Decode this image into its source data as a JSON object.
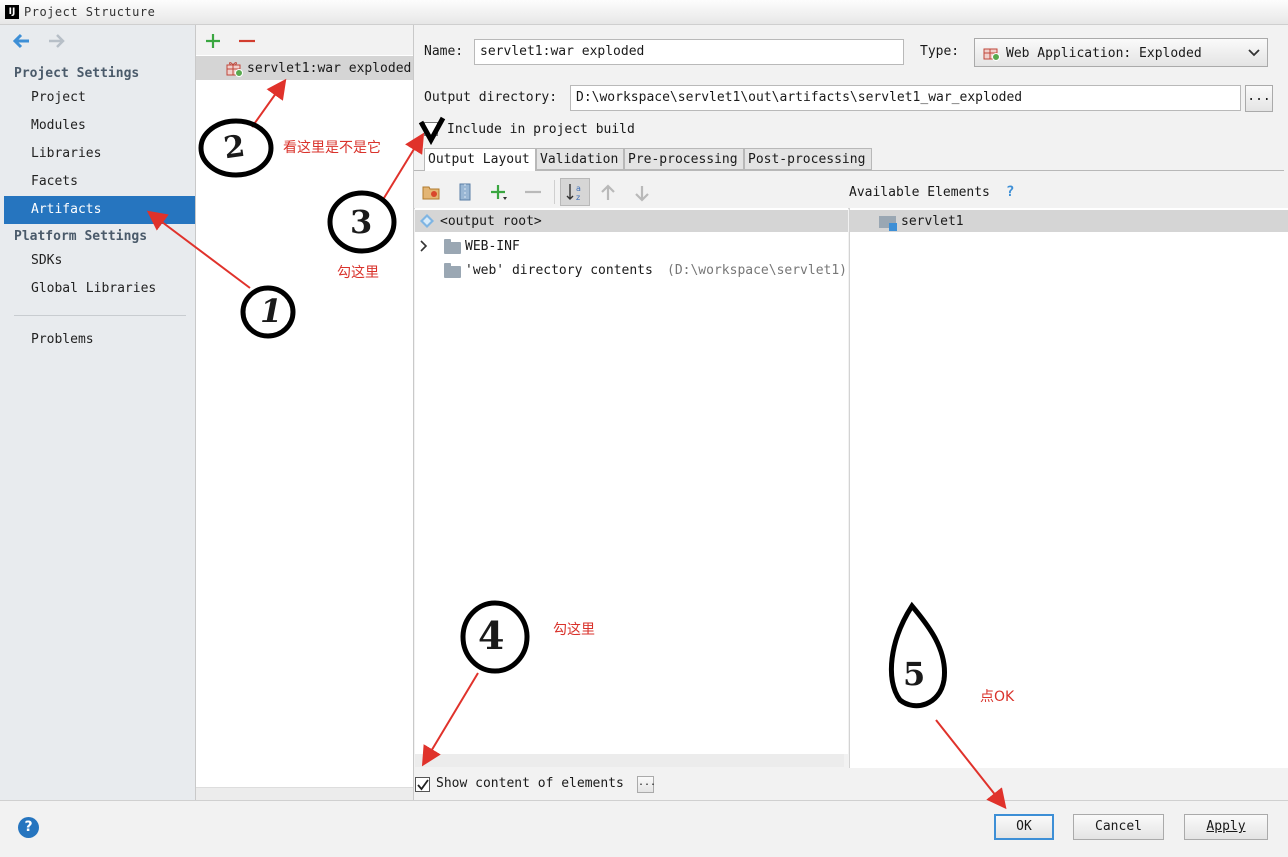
{
  "window": {
    "title": "Project Structure",
    "logo": "IJ"
  },
  "nav": {
    "section_project": "Project Settings",
    "items_project": [
      "Project",
      "Modules",
      "Libraries",
      "Facets",
      "Artifacts"
    ],
    "selected": "Artifacts",
    "section_platform": "Platform Settings",
    "items_platform": [
      "SDKs",
      "Global Libraries"
    ],
    "problems": "Problems"
  },
  "artifacts": {
    "list": [
      "servlet1:war exploded"
    ]
  },
  "form": {
    "name_label": "Name:",
    "name_value": "servlet1:war exploded",
    "type_label": "Type:",
    "type_value": "Web Application: Exploded",
    "output_label": "Output directory:",
    "output_value": "D:\\workspace\\servlet1\\out\\artifacts\\servlet1_war_exploded",
    "browse_label": "...",
    "include_label": "Include in project build",
    "include_checked": true
  },
  "tabs": [
    "Output Layout",
    "Validation",
    "Pre-processing",
    "Post-processing"
  ],
  "active_tab": "Output Layout",
  "layout": {
    "available_label": "Available Elements",
    "help": "?",
    "tree": [
      {
        "label": "<output root>",
        "selected": true
      },
      {
        "label": "WEB-INF",
        "expandable": true
      },
      {
        "label": "'web' directory contents",
        "hint": "(D:\\workspace\\servlet1)"
      }
    ],
    "available": [
      "servlet1"
    ],
    "show_content_label": "Show content of elements",
    "show_content_checked": true,
    "ellipsis": "..."
  },
  "buttons": {
    "ok": "OK",
    "cancel": "Cancel",
    "apply": "Apply"
  },
  "help_badge": "?",
  "annotations": {
    "n1": "1",
    "n2": "2",
    "n3": "3",
    "n4": "4",
    "n5": "5",
    "t2": "看这里是不是它",
    "t3": "勾这里",
    "t4": "勾这里",
    "t5": "点OK"
  },
  "colors": {
    "accent": "#2675bf",
    "annotation_red": "#e0322b",
    "add_green": "#3aa640",
    "remove_red": "#d23d2e"
  }
}
